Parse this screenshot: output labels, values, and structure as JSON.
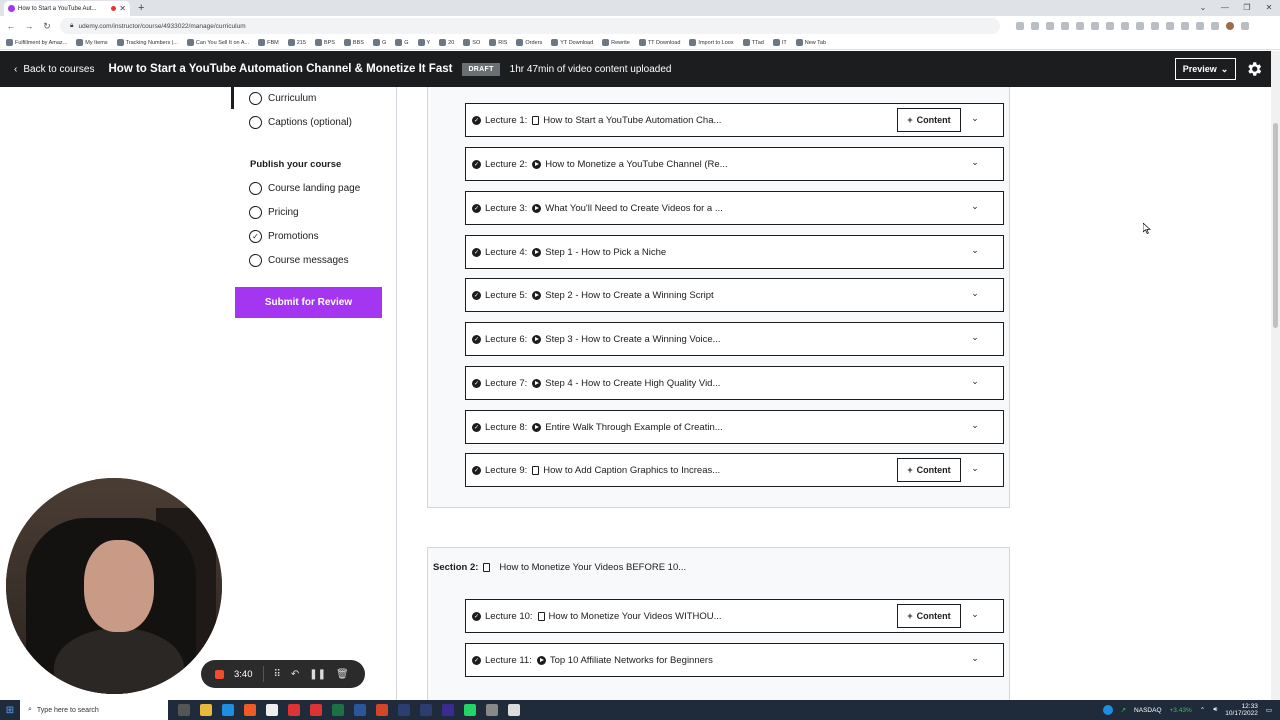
{
  "browser": {
    "tab_title": "How to Start a YouTube Aut...",
    "url": "udemy.com/instructor/course/4933022/manage/curriculum",
    "bookmarks": [
      "Fulfillment by Amaz...",
      "My Items",
      "Tracking Numbers |...",
      "Can You Sell It on A...",
      "FBM",
      "215",
      "BPS",
      "BBS",
      "G",
      "G",
      "Y",
      "20",
      "SO",
      "RIS",
      "Orders",
      "YT Download",
      "Rewrite",
      "TT Download",
      "Import to Loox",
      "TTad",
      "IT",
      "New Tab"
    ]
  },
  "header": {
    "back_label": "Back to courses",
    "course_title": "How to Start a YouTube Automation Channel & Monetize It Fast",
    "status_badge": "DRAFT",
    "uploaded_text": "1hr 47min of video content uploaded",
    "preview_label": "Preview"
  },
  "sidebar": {
    "create_items": [
      {
        "label": "Curriculum",
        "checked": false
      },
      {
        "label": "Captions (optional)",
        "checked": false
      }
    ],
    "publish_heading": "Publish your course",
    "publish_items": [
      {
        "label": "Course landing page",
        "checked": false
      },
      {
        "label": "Pricing",
        "checked": false
      },
      {
        "label": "Promotions",
        "checked": true
      },
      {
        "label": "Course messages",
        "checked": false
      }
    ],
    "submit_label": "Submit for Review"
  },
  "curriculum": {
    "content_label": "Content",
    "section1_lectures": [
      {
        "num": "Lecture 1:",
        "type": "doc",
        "title": "How to Start a YouTube Automation Cha...",
        "has_content_btn": true
      },
      {
        "num": "Lecture 2:",
        "type": "video",
        "title": "How to Monetize a YouTube Channel (Re...",
        "has_content_btn": false
      },
      {
        "num": "Lecture 3:",
        "type": "video",
        "title": "What You'll Need to Create Videos for a ...",
        "has_content_btn": false
      },
      {
        "num": "Lecture 4:",
        "type": "video",
        "title": "Step 1 - How to Pick a Niche",
        "has_content_btn": false
      },
      {
        "num": "Lecture 5:",
        "type": "video",
        "title": "Step 2 - How to Create a Winning Script",
        "has_content_btn": false
      },
      {
        "num": "Lecture 6:",
        "type": "video",
        "title": "Step 3 - How to Create a Winning Voice...",
        "has_content_btn": false
      },
      {
        "num": "Lecture 7:",
        "type": "video",
        "title": "Step 4 - How to Create High Quality Vid...",
        "has_content_btn": false
      },
      {
        "num": "Lecture 8:",
        "type": "video",
        "title": "Entire Walk Through Example of Creatin...",
        "has_content_btn": false
      },
      {
        "num": "Lecture 9:",
        "type": "doc",
        "title": "How to Add Caption Graphics to Increas...",
        "has_content_btn": true
      }
    ],
    "section2": {
      "label": "Section 2:",
      "title": "How to Monetize Your Videos BEFORE 10..."
    },
    "section2_lectures": [
      {
        "num": "Lecture 10:",
        "type": "doc",
        "title": "How to Monetize Your Videos WITHOU...",
        "has_content_btn": true
      },
      {
        "num": "Lecture 11:",
        "type": "video",
        "title": "Top 10 Affiliate Networks for Beginners",
        "has_content_btn": false
      }
    ]
  },
  "recorder": {
    "time": "3:40"
  },
  "taskbar": {
    "search_placeholder": "Type here to search",
    "ticker": "NASDAQ",
    "ticker_change": "+3.43%",
    "time": "12:33",
    "date": "10/17/2022"
  },
  "colors": {
    "accent": "#a435f0",
    "header_bg": "#1c1d1f",
    "section_bg": "#f7f9fa"
  }
}
